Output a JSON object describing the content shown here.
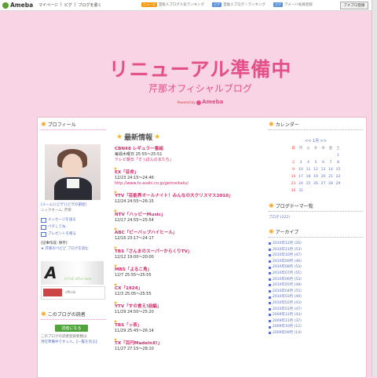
{
  "topbar": {
    "logo": "Ameba",
    "nav": [
      "マイページ",
      "|",
      "ピグ",
      "|",
      "ブログを書く"
    ],
    "ad_items": [
      {
        "badge": "ニュース",
        "text": "芸能人ブログ人気ランキング"
      },
      {
        "badge": "ピグ",
        "text": "芸能人ブログ・ランキング"
      },
      {
        "badge": "ピグ",
        "text": "アメーバ会員登録"
      }
    ],
    "login_label": "アメブロ登録"
  },
  "header": {
    "title": "リニューアル準備中",
    "subtitle": "芹那オフィシャルブログ",
    "powered_label": "Powered by",
    "powered_brand": "Ameba"
  },
  "left": {
    "profile_title": "プロフィール",
    "profile_links": "[ルーム] [ピグ] [ピグの部屋]",
    "nickname": "ニックネーム: 芹那",
    "actions": [
      "メッセージを送る",
      "ペタしてね",
      "プレゼントを贈る"
    ],
    "bio_title": "[記事作成: 保存]",
    "bio_text": "★ 芹那のペピピ ブログを読む",
    "banner1_text": "A-FILE office web",
    "banner2_text": "official",
    "reader_title": "このブログの読者",
    "reader_btn": "読者になる",
    "reader_note1": "このブログの読者登録者数は",
    "reader_note2": "現在準備中ですっ人。【一覧を見る】"
  },
  "center": {
    "news_title": "最新情報",
    "items": [
      {
        "head": "CBN48 レギュラー番組",
        "lines": [
          "毎週木曜日 25:55～25:51"
        ],
        "link": "テレビ朝日「すっぽんのまたち」"
      },
      {
        "head": "EX「芸命」",
        "lines": [
          "12/23 24:15～24:46"
        ],
        "link": "http://www.tv-asahi.co.jp/geimeikaku/"
      },
      {
        "head": "YTV「芸能界オールナイト！みんなの大クリスマス2010」",
        "lines": [
          "12/24 24:55～26:15"
        ],
        "link": ""
      },
      {
        "head": "NTV「ハッピーMusic」",
        "lines": [
          "12/17 24:55～25:54"
        ],
        "link": ""
      },
      {
        "head": "ABC「ビーバップハイヒール」",
        "lines": [
          "12/16 23:17～24:17"
        ],
        "link": ""
      },
      {
        "head": "TBS「さんまのスーパーからくりTV」",
        "lines": [
          "12/12 19:00～20:00"
        ],
        "link": ""
      },
      {
        "head": "MBS「よるこ角」",
        "lines": [
          "12/7 25:55～25:55"
        ],
        "link": ""
      },
      {
        "head": "CX「1924」",
        "lines": [
          "12/3 25:05～25:55"
        ],
        "link": ""
      },
      {
        "head": "YTV「すの食え!前編」",
        "lines": [
          "11/29 24:50～25:20"
        ],
        "link": ""
      },
      {
        "head": "TBS「ッ茶」",
        "lines": [
          "11/29 25:45～26:14"
        ],
        "link": ""
      },
      {
        "head": "TX「百円MadeInX!」",
        "lines": [
          "11/27 27:15～28:10"
        ],
        "link": ""
      }
    ]
  },
  "right": {
    "calendar_title": "カレンダー",
    "calendar_nav": "<< 1月 >>",
    "weekdays": [
      "日",
      "月",
      "火",
      "水",
      "木",
      "金",
      "土"
    ],
    "weeks": [
      [
        "",
        "",
        "",
        "",
        "",
        "",
        "1"
      ],
      [
        "2",
        "3",
        "4",
        "5",
        "6",
        "7",
        "8"
      ],
      [
        "9",
        "10",
        "11",
        "12",
        "13",
        "14",
        "15"
      ],
      [
        "16",
        "17",
        "18",
        "19",
        "20",
        "21",
        "22"
      ],
      [
        "23",
        "24",
        "25",
        "26",
        "27",
        "28",
        "29"
      ],
      [
        "30",
        "31",
        "",
        "",
        "",
        "",
        ""
      ]
    ],
    "theme_title": "ブログテーマ一覧",
    "theme_link": "ブログ (222)",
    "archive_title": "アーカイブ",
    "archives": [
      "2010年12月 (26)",
      "2010年11月 (53)",
      "2010年10月 (47)",
      "2010年09月 (46)",
      "2010年08月 (53)",
      "2010年07月 (51)",
      "2010年06月 (53)",
      "2010年05月 (48)",
      "2010年04月 (55)",
      "2010年03月 (49)",
      "2010年02月 (43)",
      "2010年01月 (47)",
      "2009年12月 (43)",
      "2009年11月 (37)",
      "2009年10月 (12)",
      "2009年09月 (14)"
    ]
  }
}
